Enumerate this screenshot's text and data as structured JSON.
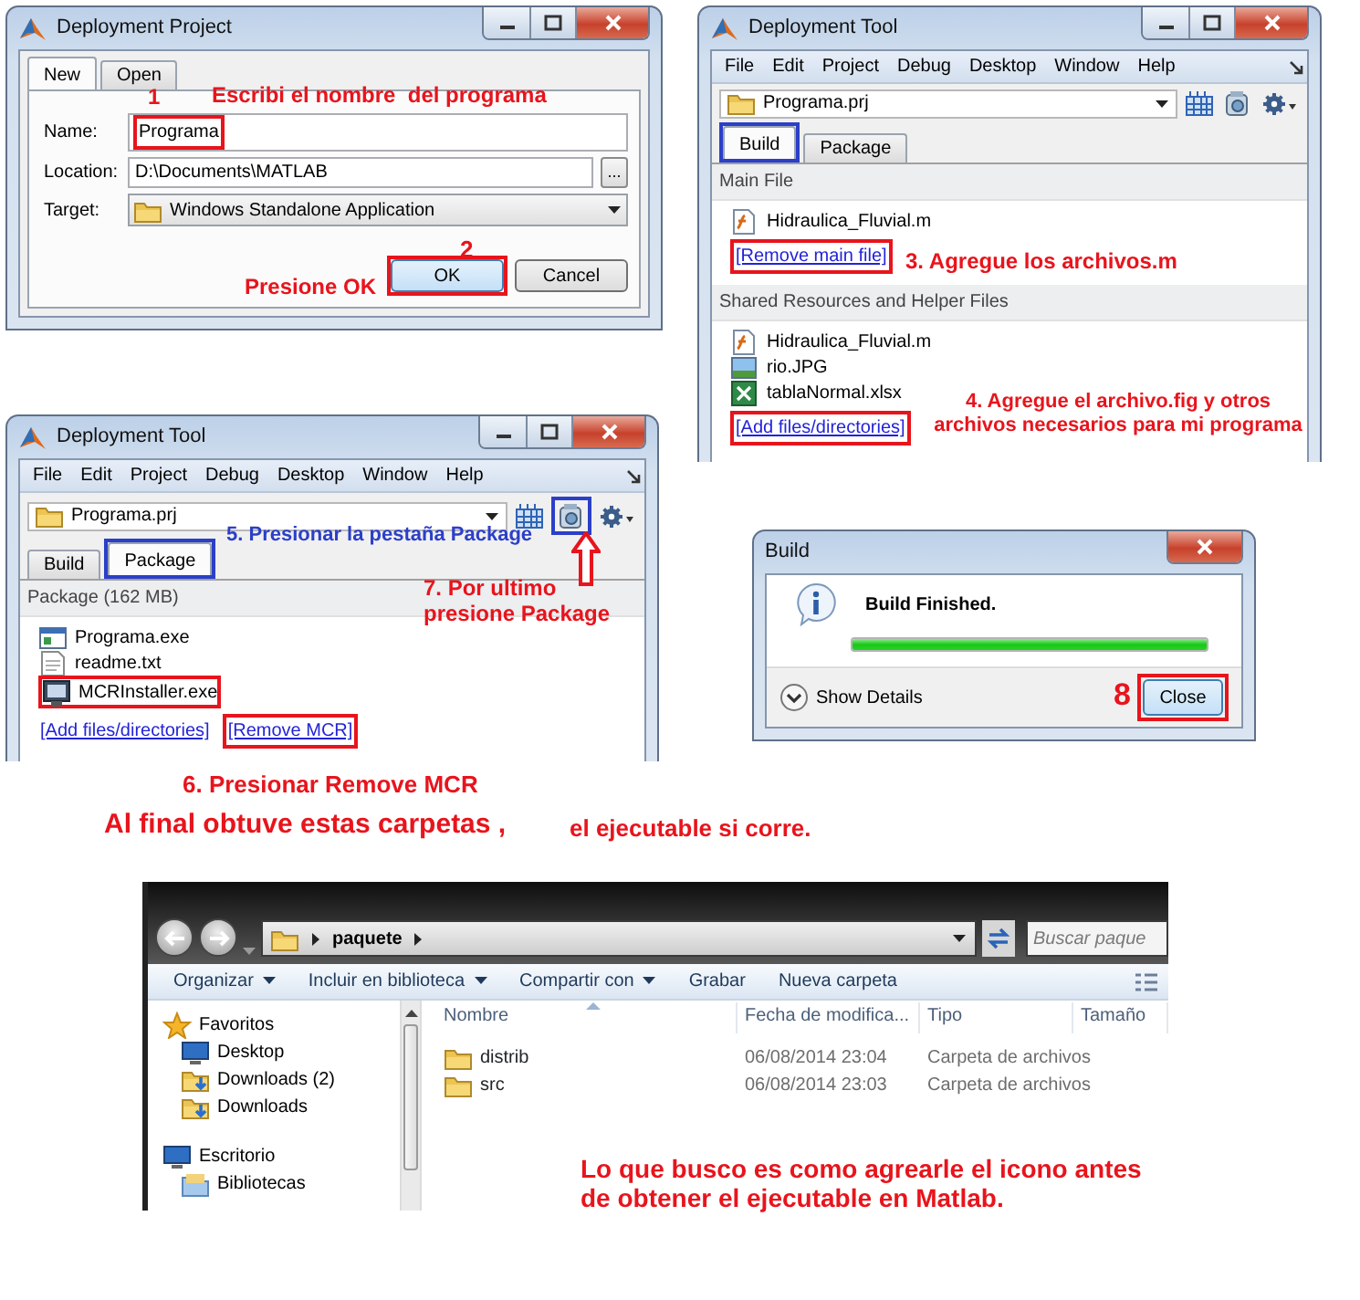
{
  "project_dialog": {
    "title": "Deployment Project",
    "tabs": [
      {
        "label": "New",
        "selected": true
      },
      {
        "label": "Open",
        "selected": false
      }
    ],
    "fields": [
      {
        "label": "Name:",
        "value": "Programa",
        "kind": "text",
        "box": {
          "color": "#e8141c"
        }
      },
      {
        "label": "Location:",
        "value": "D:\\Documents\\MATLAB",
        "kind": "browse"
      },
      {
        "label": "Target:",
        "value": "Windows Standalone Application",
        "kind": "dropdown"
      }
    ],
    "browse_button": "...",
    "buttons": [
      {
        "label": "OK",
        "default": true,
        "box": {
          "color": "#e8141c"
        }
      },
      {
        "label": "Cancel",
        "default": false
      }
    ],
    "notes": [
      {
        "text": "1",
        "color": "#e8141c"
      },
      {
        "text": "Escribi el nombre  del programa",
        "color": "#e8141c"
      },
      {
        "text": "2",
        "color": "#e8141c"
      },
      {
        "text": "Presione OK",
        "color": "#e8141c"
      }
    ]
  },
  "deploy_build": {
    "title": "Deployment Tool",
    "menu": [
      "File",
      "Edit",
      "Project",
      "Debug",
      "Desktop",
      "Window",
      "Help"
    ],
    "project": "Programa.prj",
    "toolbar": [
      {
        "kind": "build"
      },
      {
        "kind": "package"
      },
      {
        "kind": "settings"
      }
    ],
    "tabs": [
      {
        "label": "Build",
        "selected": true,
        "box": {
          "color": "#2b3fc8"
        }
      },
      {
        "label": "Package",
        "selected": false
      }
    ],
    "sections": [
      {
        "heading": "Main File",
        "files": [
          {
            "name": "Hidraulica_Fluvial.m",
            "kind": "mfile"
          }
        ],
        "links": [
          {
            "label": "[Remove main file]",
            "box": {
              "color": "#e8141c"
            }
          }
        ]
      },
      {
        "heading": "Shared Resources and Helper Files",
        "files": [
          {
            "name": "Hidraulica_Fluvial.m",
            "kind": "mfile"
          },
          {
            "name": "rio.JPG",
            "kind": "image"
          },
          {
            "name": "tablaNormal.xlsx",
            "kind": "excel"
          }
        ],
        "links": [
          {
            "label": "[Add files/directories]",
            "box": {
              "color": "#e8141c"
            }
          }
        ]
      }
    ],
    "notes": [
      {
        "text": "3. Agregue los archivos.m",
        "color": "#e8141c"
      },
      {
        "text": "4. Agregue el archivo.fig y otros archivos necesarios para mi programa",
        "color": "#e8141c"
      }
    ]
  },
  "deploy_package": {
    "title": "Deployment Tool",
    "menu": [
      "File",
      "Edit",
      "Project",
      "Debug",
      "Desktop",
      "Window",
      "Help"
    ],
    "project": "Programa.prj",
    "toolbar": [
      {
        "kind": "build"
      },
      {
        "kind": "package",
        "box": {
          "color": "#2b3fc8"
        }
      },
      {
        "kind": "settings"
      }
    ],
    "tabs": [
      {
        "label": "Build",
        "selected": false
      },
      {
        "label": "Package",
        "selected": true,
        "box": {
          "color": "#2b3fc8"
        }
      }
    ],
    "sections": [
      {
        "heading": "Package (162 MB)",
        "files": [
          {
            "name": "Programa.exe",
            "kind": "exe"
          },
          {
            "name": "readme.txt",
            "kind": "text"
          },
          {
            "name": "MCRInstaller.exe",
            "kind": "installer",
            "box": {
              "color": "#e8141c"
            }
          }
        ],
        "links": [
          {
            "label": "[Add files/directories]"
          },
          {
            "label": "[Remove MCR]",
            "box": {
              "color": "#e8141c"
            }
          }
        ]
      }
    ],
    "notes": [
      {
        "text": "5. Presionar la pestaña Package",
        "color": "#2b3fc8"
      },
      {
        "text": "7. Por ultimo presione Package",
        "color": "#e8141c"
      },
      {
        "text": "6. Presionar Remove MCR",
        "color": "#e8141c"
      }
    ]
  },
  "build_dialog": {
    "title": "Build",
    "message": "Build Finished.",
    "progress": {
      "level": 1
    },
    "details": "Show Details",
    "buttons": [
      {
        "label": "Close",
        "box": {
          "color": "#e8141c"
        }
      }
    ],
    "notes": [
      {
        "text": "8",
        "color": "#e8141c"
      }
    ]
  },
  "captions": [
    {
      "text": "Al final obtuve estas carpetas ,",
      "kind": "heading"
    },
    {
      "text": "el ejecutable si corre.",
      "kind": "aside"
    }
  ],
  "explorer": {
    "path": [
      "paquete"
    ],
    "search": {
      "placeholder": "Buscar paque"
    },
    "toolbar": [
      {
        "label": "Organizar",
        "menu": true
      },
      {
        "label": "Incluir en biblioteca",
        "menu": true
      },
      {
        "label": "Compartir con",
        "menu": true
      },
      {
        "label": "Grabar",
        "menu": false
      },
      {
        "label": "Nueva carpeta",
        "menu": false
      }
    ],
    "nav": [
      {
        "label": "Favoritos",
        "kind": "star",
        "children": [
          {
            "label": "Desktop",
            "kind": "desktop"
          },
          {
            "label": "Downloads (2)",
            "kind": "download"
          },
          {
            "label": "Downloads",
            "kind": "download"
          }
        ]
      },
      {
        "label": "Escritorio",
        "kind": "desktop",
        "children": [
          {
            "label": "Bibliotecas",
            "kind": "library"
          }
        ]
      }
    ],
    "columns": [
      {
        "label": "Nombre",
        "sorted": true
      },
      {
        "label": "Fecha de modifica...",
        "sorted": false
      },
      {
        "label": "Tipo",
        "sorted": false
      },
      {
        "label": "Tamaño",
        "sorted": false
      }
    ],
    "rows": [
      {
        "name": "distrib",
        "date": "06/08/2014 23:04",
        "type": "Carpeta de archivos"
      },
      {
        "name": "src",
        "date": "06/08/2014 23:03",
        "type": "Carpeta de archivos"
      }
    ],
    "notes": [
      {
        "text": "Lo que busco es como agrearle el icono antes de obtener el ejecutable en Matlab.",
        "color": "#e8141c"
      }
    ]
  }
}
